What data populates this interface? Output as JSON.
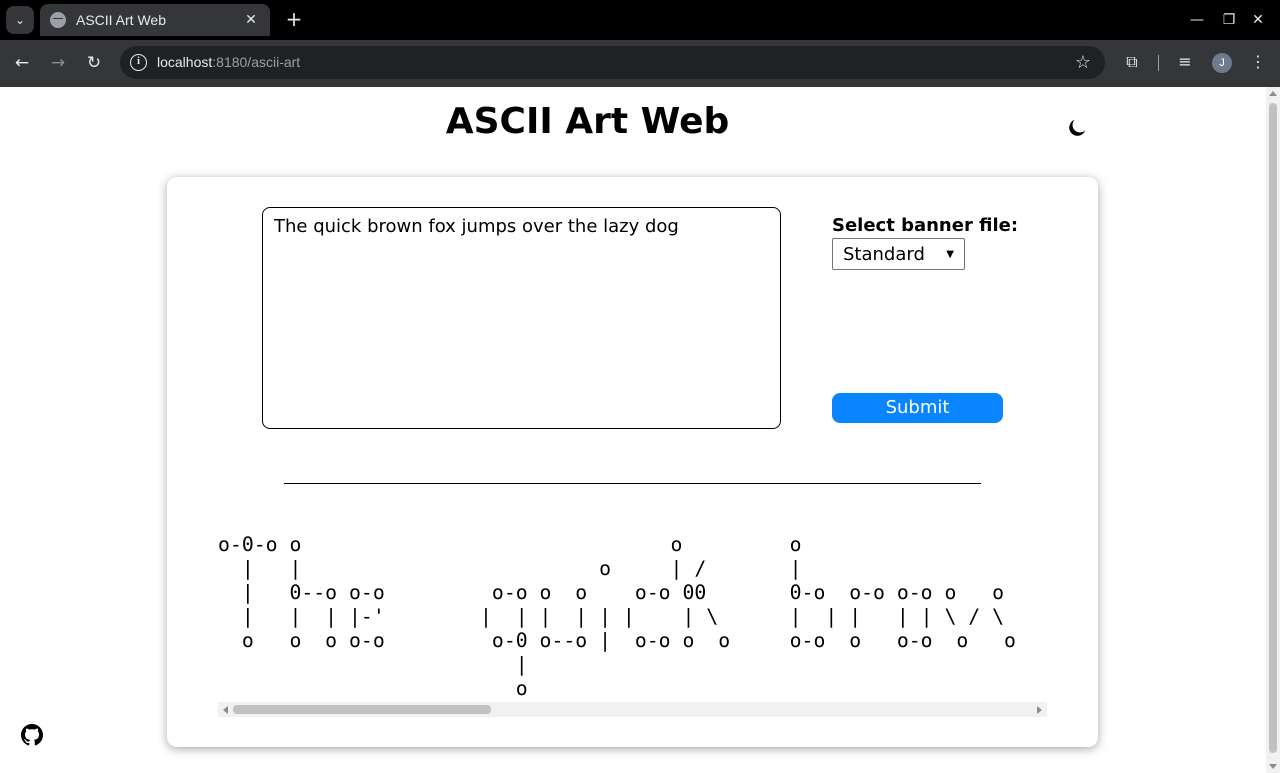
{
  "browser": {
    "tab_title": "ASCII Art Web",
    "url_host": "localhost",
    "url_path": ":8180/ascii-art",
    "avatar_letter": "J"
  },
  "page": {
    "title": "ASCII Art Web",
    "input_text": "The quick brown fox jumps over the lazy dog",
    "banner_label": "Select banner file:",
    "banner_selected": "Standard",
    "submit_label": "Submit",
    "ascii_output": "o-0-o o                               o         o                \n  |   |                         o     | /       |                \n  |   0--o o-o         o-o o  o    o-o 00       0-o  o-o o-o o   o\n  |   |  | |-'        |  | |  | | |    | \\      |  | |   | | \\ / \\\n  o   o  o o-o         o-0 o--o |  o-o o  o     o-o  o   o-o  o   o\n                         |\n                         o"
  },
  "colors": {
    "submit_bg": "#0a84ff",
    "chrome_bg": "#202124",
    "tabbar_bg": "#000000"
  },
  "icons": {
    "theme_toggle": "moon-icon",
    "footer": "github-icon"
  }
}
